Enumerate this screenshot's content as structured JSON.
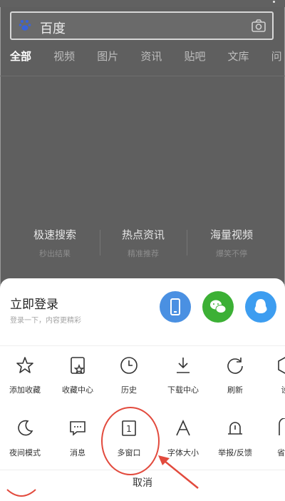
{
  "search": {
    "text": "百度"
  },
  "tabs": [
    "全部",
    "视频",
    "图片",
    "资讯",
    "贴吧",
    "文库",
    "问"
  ],
  "features": [
    {
      "title": "极速搜索",
      "subtitle": "秒出结果"
    },
    {
      "title": "热点资讯",
      "subtitle": "精准推荐"
    },
    {
      "title": "海量视频",
      "subtitle": "爆笑不停"
    }
  ],
  "login": {
    "title": "立即登录",
    "subtitle": "登录一下，内容更精彩",
    "buttons": [
      {
        "icon": "phone-icon",
        "color": "#4a90e2"
      },
      {
        "icon": "wechat-icon",
        "color": "#3cb035"
      },
      {
        "icon": "qq-icon",
        "color": "#3d9df0"
      }
    ]
  },
  "menu_row1": [
    "添加收藏",
    "收藏中心",
    "历史",
    "下载中心",
    "刷新",
    "设"
  ],
  "menu_row2": [
    "夜间模式",
    "消息",
    "多窗口",
    "字体大小",
    "举报/反馈",
    "省流"
  ],
  "multiwindow_count": "1",
  "cancel_label": "取消",
  "colors": {
    "highlight": "#e24a3d",
    "accent": "#4a90e2"
  }
}
